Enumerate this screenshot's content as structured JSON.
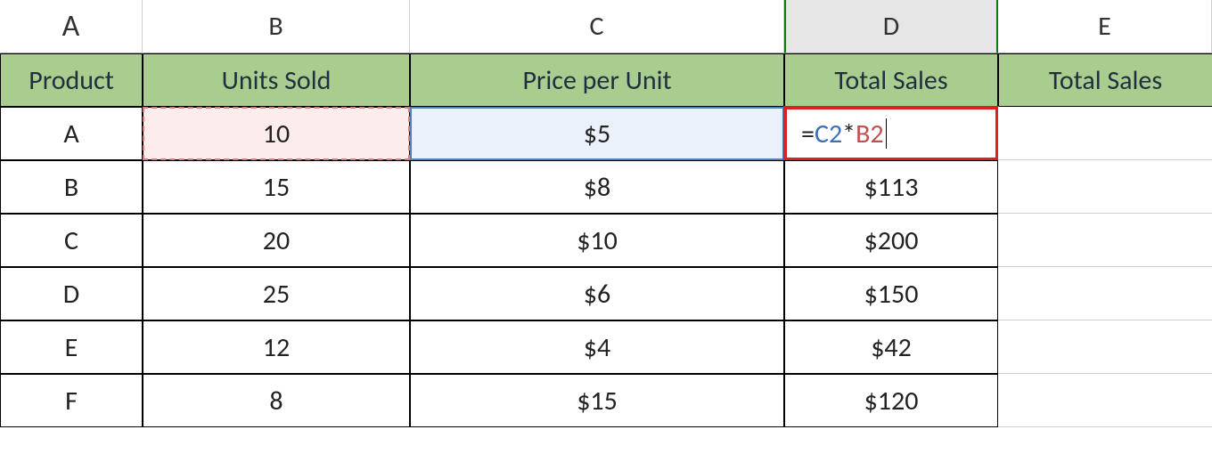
{
  "columns": {
    "A": "A",
    "B": "B",
    "C": "C",
    "D": "D",
    "E": "E"
  },
  "headers": {
    "product": "Product",
    "units_sold": "Units Sold",
    "price_per_unit": "Price per Unit",
    "total_sales_d": "Total Sales",
    "total_sales_e": "Total Sales"
  },
  "formula": {
    "eq": "=",
    "ref1": "C2",
    "op": "*",
    "ref2": "B2"
  },
  "rows": [
    {
      "product": "A",
      "units": "10",
      "price": "$5",
      "total": "=C2*B2"
    },
    {
      "product": "B",
      "units": "15",
      "price": "$8",
      "total": "$113"
    },
    {
      "product": "C",
      "units": "20",
      "price": "$10",
      "total": "$200"
    },
    {
      "product": "D",
      "units": "25",
      "price": "$6",
      "total": "$150"
    },
    {
      "product": "E",
      "units": "12",
      "price": "$4",
      "total": "$42"
    },
    {
      "product": "F",
      "units": "8",
      "price": "$15",
      "total": "$120"
    }
  ],
  "chart_data": {
    "type": "table",
    "columns": [
      "Product",
      "Units Sold",
      "Price per Unit",
      "Total Sales"
    ],
    "rows": [
      [
        "A",
        10,
        5,
        null
      ],
      [
        "B",
        15,
        8,
        113
      ],
      [
        "C",
        20,
        10,
        200
      ],
      [
        "D",
        25,
        6,
        150
      ],
      [
        "E",
        12,
        4,
        42
      ],
      [
        "F",
        8,
        15,
        120
      ]
    ],
    "active_cell": "D2",
    "active_formula": "=C2*B2"
  }
}
